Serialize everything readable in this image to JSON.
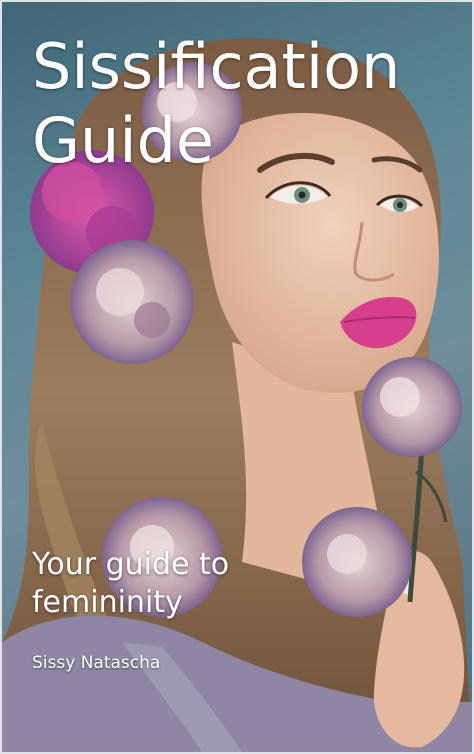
{
  "cover": {
    "title": "Sissification Guide",
    "subtitle": "Your guide to femininity",
    "author": "Sissy Natascha"
  },
  "colors": {
    "background": "#4f7585",
    "hair": "#8a6a4e",
    "skin": "#e9c2a8",
    "lips": "#d63f8c",
    "flower_magenta": "#b5479b",
    "flower_dusty_pink": "#b89aa6",
    "text": "#ffffff"
  },
  "illustration": {
    "subject": "woman-portrait",
    "elements": [
      "hair",
      "face",
      "carnation-flowers",
      "hand",
      "dress"
    ]
  }
}
